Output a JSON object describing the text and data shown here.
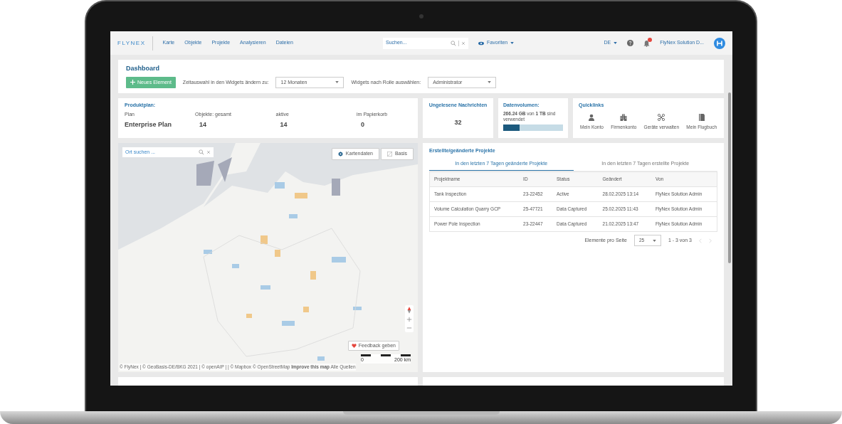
{
  "navbar": {
    "logo": "FLYNEX",
    "items": [
      "Karte",
      "Objekte",
      "Projekte",
      "Analysieren",
      "Dateien"
    ],
    "search": {
      "placeholder": "Suchen..."
    },
    "favorites": "Favoriten",
    "language": "DE",
    "user": "FlyNex Solution D..."
  },
  "dashboard": {
    "title": "Dashboard",
    "new_button": "Neues Element",
    "time_label": "Zeitauswahl in den Widgets ändern zu:",
    "time_select": "12 Monaten",
    "role_label": "Widgets nach Rolle auswählen:",
    "role_select": "Administrator"
  },
  "product_plan": {
    "title": "Produktplan:",
    "columns": [
      {
        "label": "Plan",
        "value": "Enterprise Plan"
      },
      {
        "label": "Objekte: gesamt",
        "value": "14"
      },
      {
        "label": "aktive",
        "value": "14"
      },
      {
        "label": "im Papierkorb",
        "value": "0"
      }
    ]
  },
  "messages": {
    "title": "Ungelesene Nachrichten",
    "value": "32"
  },
  "data_volume": {
    "title": "Datenvolumen:",
    "text": "**266.24 GB** von **1 TB** sind verwendet",
    "level": 0.27
  },
  "quicklinks": {
    "title": "Quicklinks",
    "items": [
      {
        "kind": "person",
        "label": "Mein Konto"
      },
      {
        "kind": "building",
        "label": "Firmenkonto"
      },
      {
        "kind": "drone",
        "label": "Geräte verwalten"
      },
      {
        "kind": "book",
        "label": "Mein Flugbuch"
      }
    ]
  },
  "map": {
    "search": {
      "placeholder": "Ort suchen ..."
    },
    "buttons": [
      "Kartendaten",
      "Basis"
    ],
    "feedback": "Feedback geben",
    "scale": [
      "0",
      "200 km"
    ],
    "attribution": "© FlyNex | © GeoBasis-DE/BKG 2021 | © openAIP | | © Mapbox © OpenStreetMap **Improve this map** Alle Quellen"
  },
  "projects": {
    "title": "Erstellte/geänderte Projekte",
    "tabs": [
      {
        "label": "In den letzten 7 Tagen geänderte Projekte",
        "selected": true
      },
      {
        "label": "In den letzten 7 Tagen erstellte Projekte",
        "selected": false
      }
    ],
    "columns": [
      "Projektname",
      "ID",
      "Status",
      "Geändert",
      "Von"
    ],
    "rows": [
      [
        "Tank Inspection",
        "23-22452",
        "Active",
        "28.02.2025 13:14",
        "FlyNex Solution Admin"
      ],
      [
        "Volume Calculation Quarry GCP",
        "25-47721",
        "Data Captured",
        "25.02.2025 11:43",
        "FlyNex Solution Admin"
      ],
      [
        "Power Pole Inspection",
        "23-22447",
        "Data Captured",
        "21.02.2025 13:47",
        "FlyNex Solution Admin"
      ]
    ],
    "page_size_label": "Elemente pro Seite",
    "page_size": "25",
    "range": "1 - 3 von 3"
  }
}
